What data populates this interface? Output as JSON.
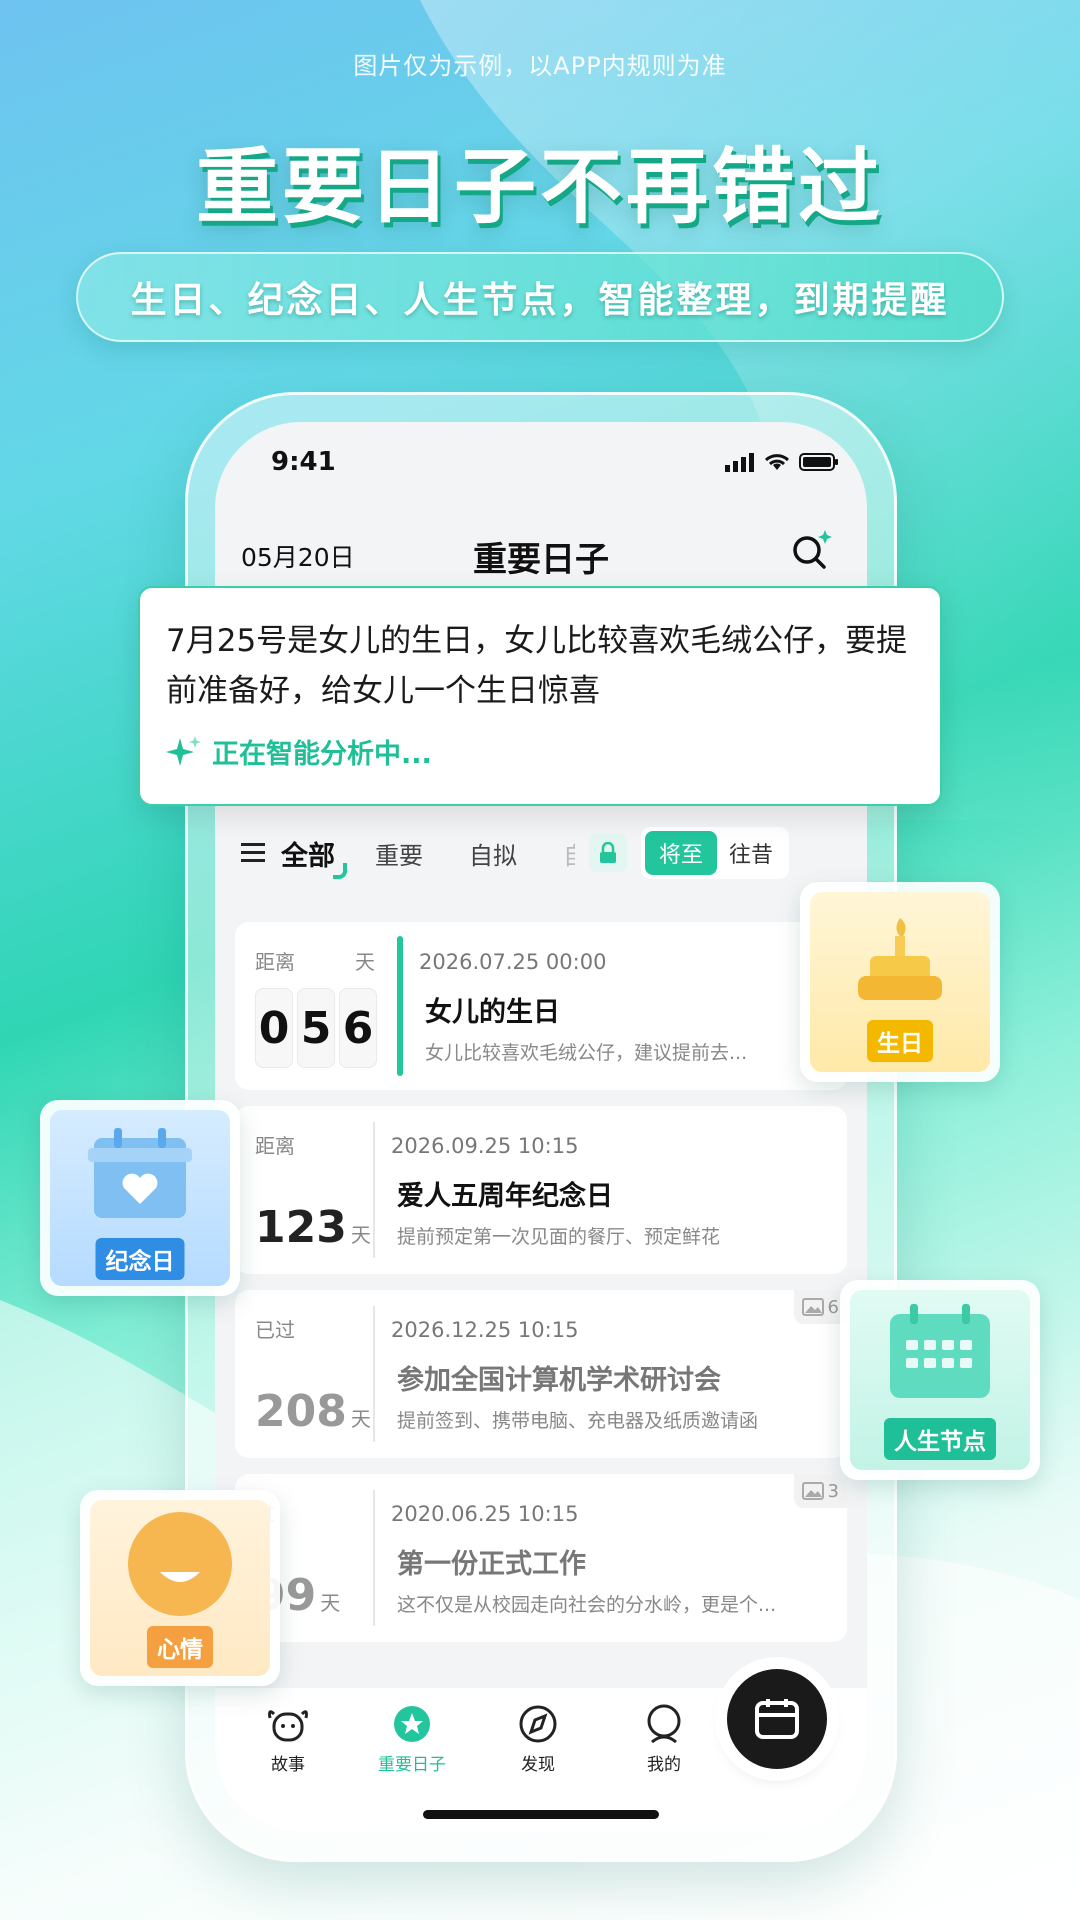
{
  "disclaimer": "图片仅为示例，以APP内规则为准",
  "hero": {
    "title": "重要日子不再错过",
    "subtitle": "生日、纪念日、人生节点，智能整理，到期提醒"
  },
  "status_bar": {
    "time": "9:41"
  },
  "nav": {
    "date": "05月20日",
    "title": "重要日子"
  },
  "ai_input": {
    "text": "7月25号是女儿的生日，女儿比较喜欢毛绒公仔，要提前准备好，给女儿一个生日惊喜",
    "status": "正在智能分析中..."
  },
  "filters": {
    "tabs": [
      "全部",
      "重要",
      "自拟",
      "自"
    ],
    "segment": [
      "将至",
      "往昔"
    ],
    "active_segment": "将至"
  },
  "events": [
    {
      "label": "距离",
      "unit": "天",
      "digits": [
        "0",
        "5",
        "6"
      ],
      "datetime": "2026.07.25 00:00",
      "title": "女儿的生日",
      "desc": "女儿比较喜欢毛绒公仔，建议提前去...",
      "highlight": true
    },
    {
      "label": "距离",
      "number": "123",
      "unit": "天",
      "datetime": "2026.09.25 10:15",
      "title": "爱人五周年纪念日",
      "desc": "提前预定第一次见面的餐厅、预定鲜花"
    },
    {
      "label": "已过",
      "number": "208",
      "unit": "天",
      "datetime": "2026.12.25 10:15",
      "title": "参加全国计算机学术研讨会",
      "desc": "提前签到、携带电脑、充电器及纸质邀请函",
      "images": "6",
      "past": true
    },
    {
      "label": "过",
      "number": "99",
      "unit": "天",
      "datetime": "2020.06.25 10:15",
      "title": "第一份正式工作",
      "desc": "这不仅是从校园走向社会的分水岭，更是个...",
      "images": "3",
      "past": true
    }
  ],
  "tabbar": [
    {
      "label": "故事",
      "icon": "cow-face-icon"
    },
    {
      "label": "重要日子",
      "icon": "star-badge-icon",
      "active": true
    },
    {
      "label": "发现",
      "icon": "compass-icon"
    },
    {
      "label": "我的",
      "icon": "user-icon"
    }
  ],
  "fab_icon": "calendar-icon",
  "tags": {
    "birthday": "生日",
    "anniversary": "纪念日",
    "milestone": "人生节点",
    "mood": "心情"
  },
  "colors": {
    "accent": "#22c59c",
    "birthday_tag": "#f5b800",
    "anniversary_tag": "#2f8de4",
    "milestone_tag": "#1fbf98",
    "mood_tag": "#f5a040"
  }
}
